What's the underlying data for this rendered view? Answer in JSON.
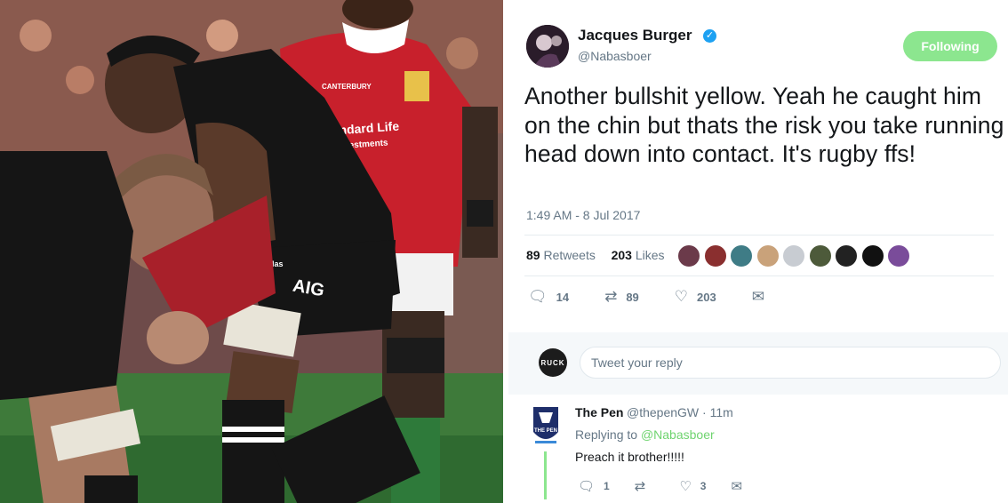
{
  "photo": {
    "sponsor_shirt": "Standard Life Investments",
    "sponsor_line1": "Standard Life",
    "sponsor_line2": "Investments",
    "shorts_mark": "AIG",
    "kit_brand": "adidas",
    "chest_brand": "CANTERBURY"
  },
  "tweet": {
    "author_name": "Jacques Burger",
    "author_handle": "@Nabasboer",
    "verified": true,
    "follow_label": "Following",
    "text": "Another bullshit yellow. Yeah he caught him on the chin but thats the risk you take running head down into contact. It's rugby ffs!",
    "timestamp": "1:49 AM - 8 Jul 2017",
    "retweets_count": "89",
    "retweets_label": "Retweets",
    "likes_count": "203",
    "likes_label": "Likes",
    "actions": {
      "reply_count": "14",
      "retweet_count": "89",
      "like_count": "203"
    },
    "liker_colors": [
      "#6b3a4a",
      "#8a2f2f",
      "#3f7c86",
      "#c9a27a",
      "#c8ccd2",
      "#4d5a3a",
      "#222222",
      "#111111",
      "#7a4c9a"
    ]
  },
  "reply_box": {
    "avatar_label": "RUCK",
    "placeholder": "Tweet your reply"
  },
  "reply": {
    "author_name": "The Pen",
    "author_handle": "@thepenGW · 11m",
    "replying_prefix": "Replying to",
    "replying_mention": "@Nabasboer",
    "text": "Preach it brother!!!!!",
    "reply_count": "1",
    "like_count": "3",
    "logo_text": "THE PEN"
  },
  "colors": {
    "accent_green": "#8ce68f",
    "twitter_blue": "#1da1f2",
    "lions_red": "#c8202c",
    "all_blacks": "#151515"
  },
  "icons": {
    "reply": "reply-icon",
    "retweet": "retweet-icon",
    "like": "heart-icon",
    "dm": "envelope-icon"
  }
}
